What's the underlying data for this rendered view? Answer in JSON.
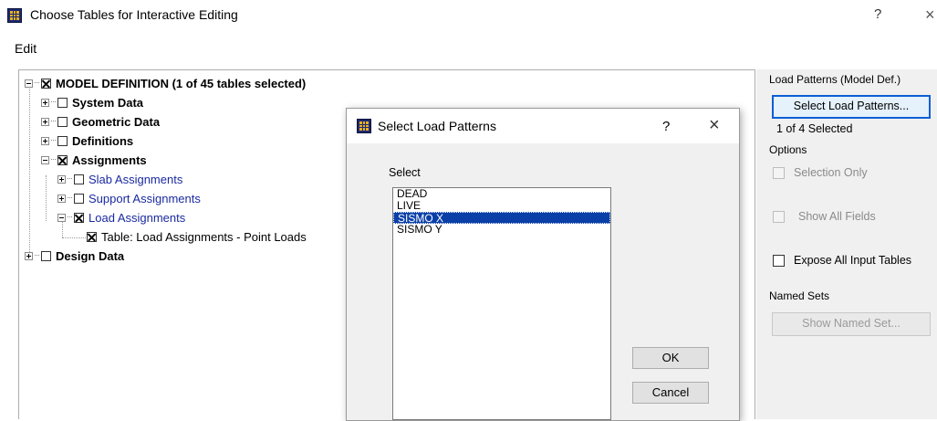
{
  "window": {
    "title": "Choose Tables for Interactive Editing",
    "help": "?",
    "close": "×"
  },
  "menu": {
    "edit": "Edit"
  },
  "tree": {
    "root": "MODEL DEFINITION  (1 of 45 tables selected)",
    "items": [
      "System Data",
      "Geometric Data",
      "Definitions",
      "Assignments",
      "Slab Assignments",
      "Support Assignments",
      "Load Assignments",
      "Table:  Load Assignments - Point Loads",
      "Design Data"
    ]
  },
  "right_panel": {
    "load_patterns_label": "Load Patterns (Model Def.)",
    "select_button": "Select Load Patterns...",
    "selected_count": "1 of 4 Selected",
    "options_label": "Options",
    "selection_only": "Selection Only",
    "show_all_fields": "Show All Fields",
    "expose_all": "Expose All Input Tables",
    "named_sets_label": "Named Sets",
    "show_named_set": "Show Named Set..."
  },
  "dialog": {
    "title": "Select Load Patterns",
    "help": "?",
    "close": "×",
    "select_label": "Select",
    "patterns": [
      "DEAD",
      "LIVE",
      "SISMO X",
      "SISMO Y"
    ],
    "selected_index": 2,
    "ok": "OK",
    "cancel": "Cancel"
  }
}
